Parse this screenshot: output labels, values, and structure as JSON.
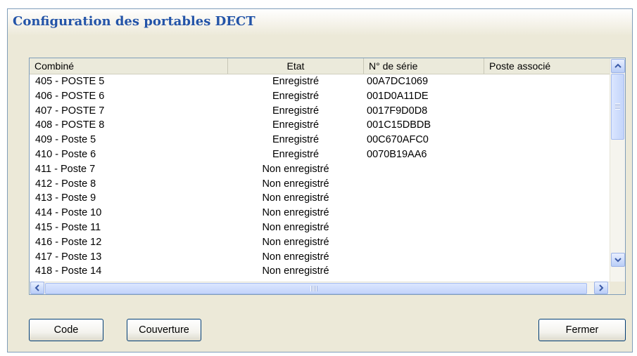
{
  "window": {
    "title": "Configuration des portables DECT"
  },
  "table": {
    "columns": [
      "Combiné",
      "Etat",
      "N° de série",
      "Poste associé"
    ],
    "rows": [
      {
        "combine": "405 - POSTE 5",
        "etat": "Enregistré",
        "serie": "00A7DC1069",
        "poste": ""
      },
      {
        "combine": "406 - POSTE 6",
        "etat": "Enregistré",
        "serie": "001D0A11DE",
        "poste": ""
      },
      {
        "combine": "407 - POSTE 7",
        "etat": "Enregistré",
        "serie": "0017F9D0D8",
        "poste": ""
      },
      {
        "combine": "408 - POSTE 8",
        "etat": "Enregistré",
        "serie": "001C15DBDB",
        "poste": ""
      },
      {
        "combine": "409 - Poste 5",
        "etat": "Enregistré",
        "serie": "00C670AFC0",
        "poste": ""
      },
      {
        "combine": "410 - Poste 6",
        "etat": "Enregistré",
        "serie": "0070B19AA6",
        "poste": ""
      },
      {
        "combine": "411 - Poste 7",
        "etat": "Non enregistré",
        "serie": "",
        "poste": ""
      },
      {
        "combine": "412 - Poste 8",
        "etat": "Non enregistré",
        "serie": "",
        "poste": ""
      },
      {
        "combine": "413 - Poste 9",
        "etat": "Non enregistré",
        "serie": "",
        "poste": ""
      },
      {
        "combine": "414 - Poste 10",
        "etat": "Non enregistré",
        "serie": "",
        "poste": ""
      },
      {
        "combine": "415 - Poste 11",
        "etat": "Non enregistré",
        "serie": "",
        "poste": ""
      },
      {
        "combine": "416 - Poste 12",
        "etat": "Non enregistré",
        "serie": "",
        "poste": ""
      },
      {
        "combine": "417 - Poste 13",
        "etat": "Non enregistré",
        "serie": "",
        "poste": ""
      },
      {
        "combine": "418 - Poste 14",
        "etat": "Non enregistré",
        "serie": "",
        "poste": ""
      }
    ]
  },
  "buttons": {
    "code": "Code",
    "couverture": "Couverture",
    "fermer": "Fermer"
  },
  "icons": {
    "scroll_up": "chevron-up-icon",
    "scroll_down": "chevron-down-icon",
    "scroll_left": "chevron-left-icon",
    "scroll_right": "chevron-right-icon"
  },
  "colors": {
    "title_text": "#2354a8",
    "window_bg": "#ece9d8",
    "button_border": "#003c74",
    "list_border": "#7f9db9"
  }
}
